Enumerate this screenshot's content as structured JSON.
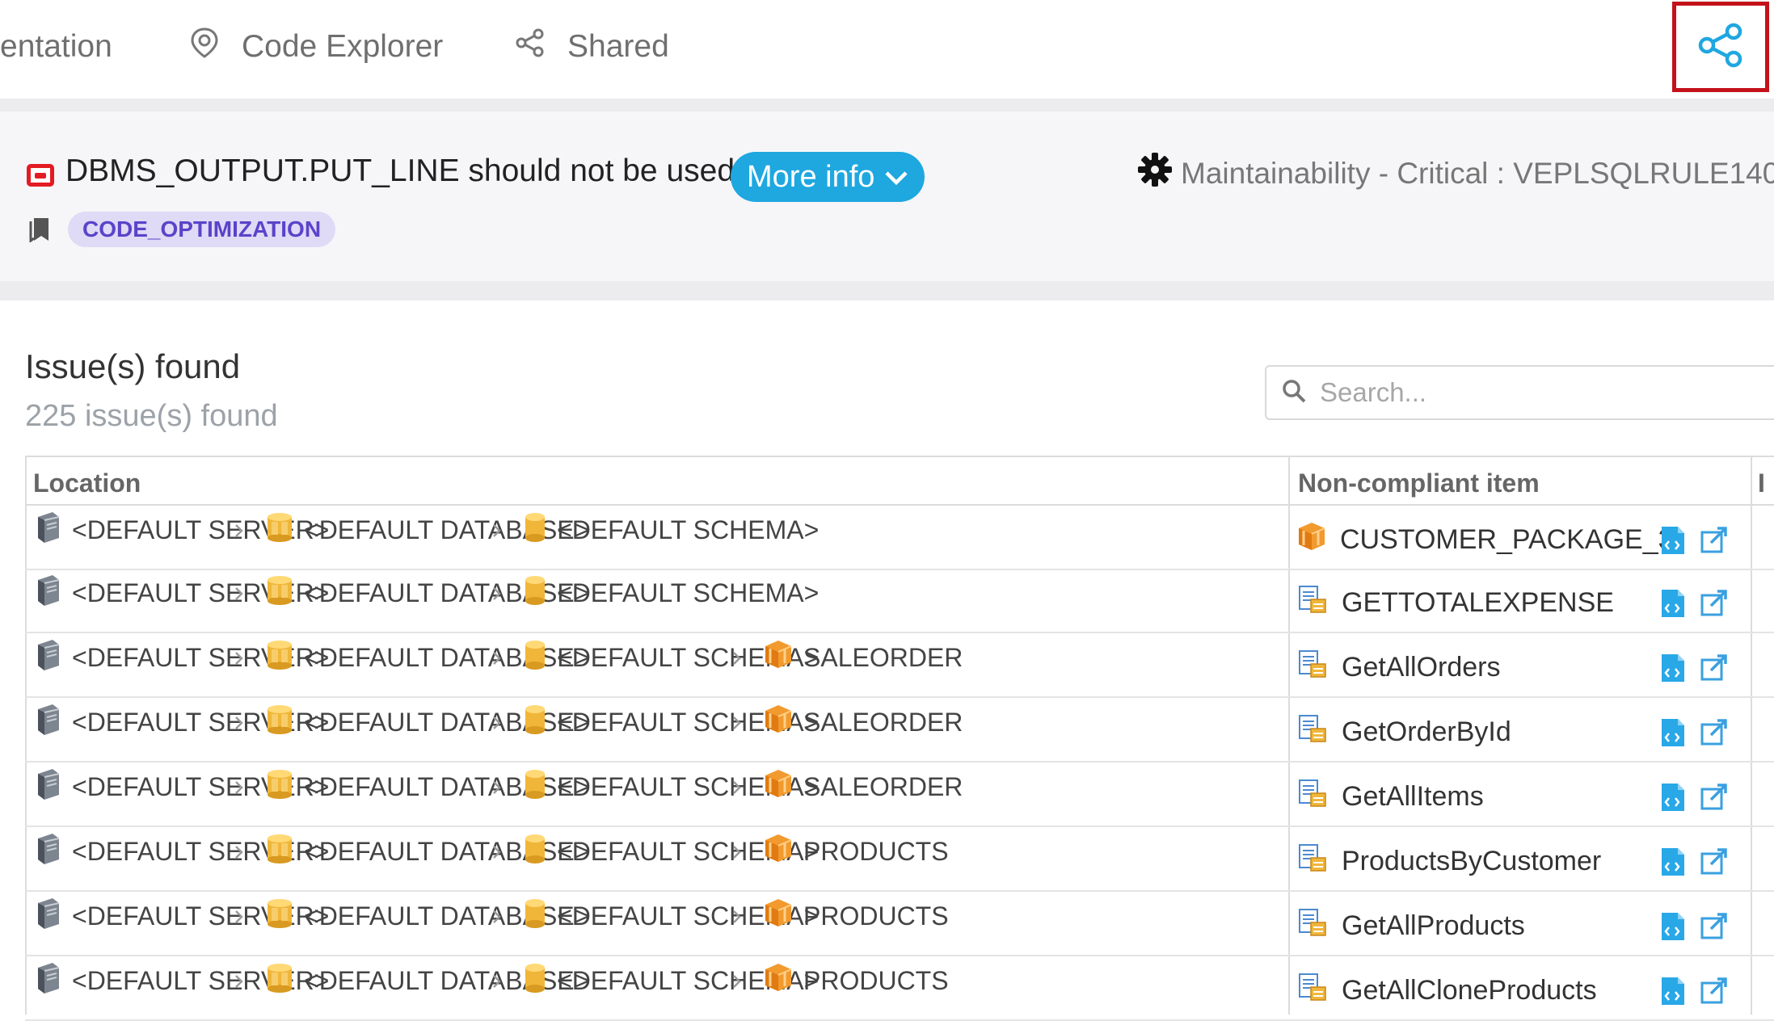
{
  "nav": {
    "items": [
      {
        "label": "entation",
        "icon": "documentation-icon"
      },
      {
        "label": "Code Explorer",
        "icon": "code-explorer-icon"
      },
      {
        "label": "Shared",
        "icon": "share-icon"
      }
    ],
    "share_button_icon": "share-icon",
    "accent_color": "#c4121a"
  },
  "rule": {
    "title": "DBMS_OUTPUT.PUT_LINE should not be used",
    "severity_icon": "stop-icon",
    "more_info_label": "More info",
    "meta_text": "Maintainability - Critical : VEPLSQLRULE140",
    "tag": "CODE_OPTIMIZATION",
    "colors": {
      "button": "#1fa7e0",
      "tag_bg": "#dfdaf6",
      "tag_text": "#5b43c9",
      "severity": "#e31b23"
    }
  },
  "issues": {
    "title": "Issue(s) found",
    "count_text": "225 issue(s) found",
    "search_placeholder": "Search..."
  },
  "table": {
    "columns": [
      "Location",
      "Non-compliant item",
      "I"
    ],
    "rows": [
      {
        "location": [
          "<DEFAULT SERVER>",
          "<DEFAULT DATABASE>",
          "<DEFAULT SCHEMA>"
        ],
        "item": "CUSTOMER_PACKAGE_3",
        "item_type": "package-icon"
      },
      {
        "location": [
          "<DEFAULT SERVER>",
          "<DEFAULT DATABASE>",
          "<DEFAULT SCHEMA>"
        ],
        "item": "GETTOTALEXPENSE",
        "item_type": "procedure-icon"
      },
      {
        "location": [
          "<DEFAULT SERVER>",
          "<DEFAULT DATABASE>",
          "<DEFAULT SCHEMA>",
          "SALEORDER"
        ],
        "item": "GetAllOrders",
        "item_type": "procedure-icon"
      },
      {
        "location": [
          "<DEFAULT SERVER>",
          "<DEFAULT DATABASE>",
          "<DEFAULT SCHEMA>",
          "SALEORDER"
        ],
        "item": "GetOrderById",
        "item_type": "procedure-icon"
      },
      {
        "location": [
          "<DEFAULT SERVER>",
          "<DEFAULT DATABASE>",
          "<DEFAULT SCHEMA>",
          "SALEORDER"
        ],
        "item": "GetAllItems",
        "item_type": "procedure-icon"
      },
      {
        "location": [
          "<DEFAULT SERVER>",
          "<DEFAULT DATABASE>",
          "<DEFAULT SCHEMA>",
          "PRODUCTS"
        ],
        "item": "ProductsByCustomer",
        "item_type": "procedure-icon"
      },
      {
        "location": [
          "<DEFAULT SERVER>",
          "<DEFAULT DATABASE>",
          "<DEFAULT SCHEMA>",
          "PRODUCTS"
        ],
        "item": "GetAllProducts",
        "item_type": "procedure-icon"
      },
      {
        "location": [
          "<DEFAULT SERVER>",
          "<DEFAULT DATABASE>",
          "<DEFAULT SCHEMA>",
          "PRODUCTS"
        ],
        "item": "GetAllCloneProducts",
        "item_type": "procedure-icon"
      }
    ],
    "segment_icons": [
      "server-icon",
      "database-icon",
      "schema-icon",
      "package-icon"
    ],
    "action_icons": [
      "view-code-icon",
      "open-external-icon"
    ]
  }
}
